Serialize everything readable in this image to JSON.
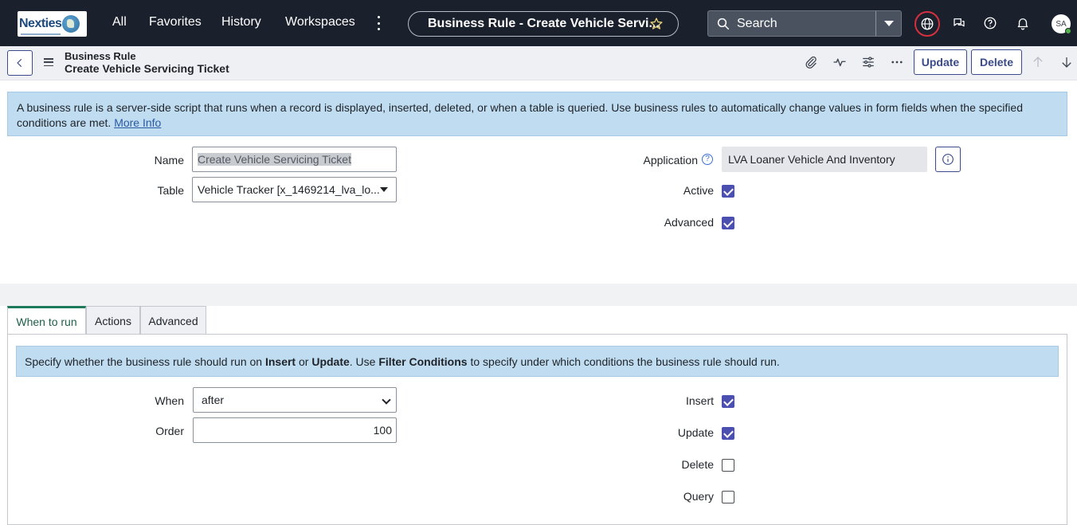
{
  "nav": {
    "logo_text": "Nexties",
    "links": [
      "All",
      "Favorites",
      "History",
      "Workspaces"
    ],
    "title_pill": "Business Rule - Create Vehicle Servi...",
    "search_label": "Search",
    "avatar_initials": "SA"
  },
  "formbar": {
    "record_type": "Business Rule",
    "record_name": "Create Vehicle Servicing Ticket",
    "update_label": "Update",
    "delete_label": "Delete"
  },
  "info_banner": {
    "text": "A business rule is a server-side script that runs when a record is displayed, inserted, deleted, or when a table is queried. Use business rules to automatically change values in form fields when the specified conditions are met.",
    "link": "More Info"
  },
  "fields": {
    "name_label": "Name",
    "name_value": "Create Vehicle Servicing Ticket",
    "table_label": "Table",
    "table_value": "Vehicle Tracker [x_1469214_lva_lo...",
    "application_label": "Application",
    "application_value": "LVA Loaner Vehicle And Inventory",
    "active_label": "Active",
    "active": true,
    "advanced_label": "Advanced",
    "advanced": true
  },
  "tabs": [
    {
      "label": "When to run",
      "active": true
    },
    {
      "label": "Actions",
      "active": false
    },
    {
      "label": "Advanced",
      "active": false
    }
  ],
  "when_to_run": {
    "banner_pre": "Specify whether the business rule should run on ",
    "banner_b1": "Insert",
    "banner_or": " or ",
    "banner_b2": "Update",
    "banner_mid": ". Use ",
    "banner_b3": "Filter Conditions",
    "banner_post": " to specify under which conditions the business rule should run.",
    "when_label": "When",
    "when_value": "after",
    "order_label": "Order",
    "order_value": "100",
    "insert_label": "Insert",
    "insert": true,
    "update_label": "Update",
    "update": true,
    "delete_label": "Delete",
    "delete": false,
    "query_label": "Query",
    "query": false
  },
  "colors": {
    "nav_bg": "#1a202c",
    "accent": "#3b4a8a",
    "checkbox_on": "#4b4fb0",
    "info_bg": "#bfdcf1",
    "tab_active": "#1f7a5c"
  }
}
